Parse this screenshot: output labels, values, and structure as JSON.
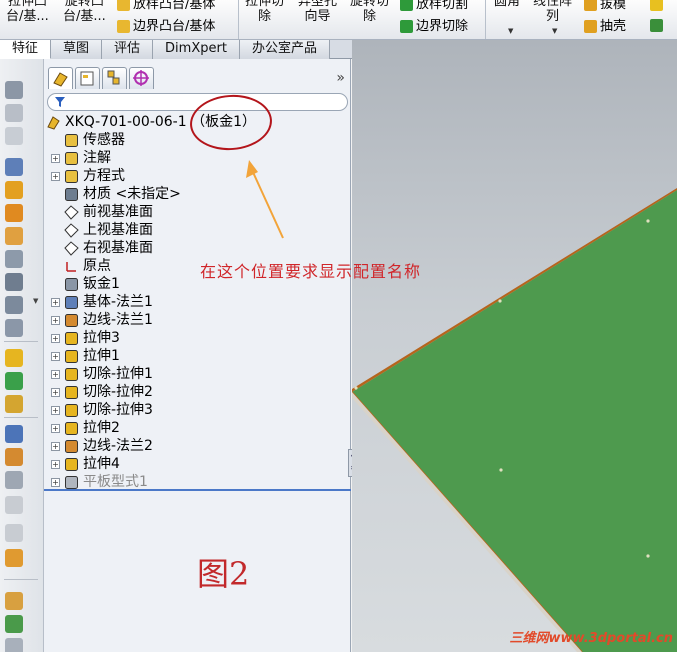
{
  "ribbon": {
    "commands": [
      {
        "line1": "拉伸凸",
        "line2": "台/基..."
      },
      {
        "line1": "旋转凸",
        "line2": "台/基..."
      },
      {
        "line1": "拉伸切",
        "line2": "除"
      },
      {
        "line1": "异型孔",
        "line2": "向导"
      },
      {
        "line1": "旋转切",
        "line2": "除"
      },
      {
        "line1": "圆角",
        "line2": ""
      },
      {
        "line1": "线性阵",
        "line2": "列"
      }
    ],
    "small": [
      {
        "label": "放样凸台/基体"
      },
      {
        "label": "边界凸台/基体"
      },
      {
        "label": "放样切割"
      },
      {
        "label": "边界切除"
      },
      {
        "label": "拔模"
      },
      {
        "label": "抽壳"
      }
    ]
  },
  "tabs": [
    "特征",
    "草图",
    "评估",
    "DimXpert",
    "办公室产品"
  ],
  "tree": {
    "root": "XKQ-701-00-06-1 （板金1）",
    "items": [
      {
        "label": "传感器",
        "expand": false,
        "icon": "sensor-icon"
      },
      {
        "label": "注解",
        "expand": true,
        "icon": "annotation-icon"
      },
      {
        "label": "方程式",
        "expand": true,
        "icon": "equation-icon"
      },
      {
        "label": "材质 <未指定>",
        "expand": false,
        "icon": "material-icon"
      },
      {
        "label": "前视基准面",
        "expand": false,
        "icon": "plane-icon"
      },
      {
        "label": "上视基准面",
        "expand": false,
        "icon": "plane-icon"
      },
      {
        "label": "右视基准面",
        "expand": false,
        "icon": "plane-icon"
      },
      {
        "label": "原点",
        "expand": false,
        "icon": "origin-icon"
      },
      {
        "label": "钣金1",
        "expand": false,
        "icon": "sheetmetal-icon"
      },
      {
        "label": "基体-法兰1",
        "expand": true,
        "icon": "base-flange-icon"
      },
      {
        "label": "边线-法兰1",
        "expand": true,
        "icon": "edge-flange-icon"
      },
      {
        "label": "拉伸3",
        "expand": true,
        "icon": "extrude-icon"
      },
      {
        "label": "拉伸1",
        "expand": true,
        "icon": "extrude-icon"
      },
      {
        "label": "切除-拉伸1",
        "expand": true,
        "icon": "cut-extrude-icon"
      },
      {
        "label": "切除-拉伸2",
        "expand": true,
        "icon": "cut-extrude-icon"
      },
      {
        "label": "切除-拉伸3",
        "expand": true,
        "icon": "cut-extrude-icon"
      },
      {
        "label": "拉伸2",
        "expand": true,
        "icon": "extrude-icon"
      },
      {
        "label": "边线-法兰2",
        "expand": true,
        "icon": "edge-flange-icon"
      },
      {
        "label": "拉伸4",
        "expand": true,
        "icon": "extrude-icon"
      },
      {
        "label": "平板型式1",
        "expand": true,
        "icon": "flat-pattern-icon",
        "dim": true
      }
    ]
  },
  "annotation": {
    "text": "在这个位置要求显示配置名称",
    "figure_label": "图2"
  },
  "watermark": "三维网www.3dportal.cn",
  "colors": {
    "annotation_red": "#c2292b",
    "plate_green": "#4e9a4e",
    "plate_edge": "#b5651d",
    "arrow_orange": "#f2a43a"
  }
}
